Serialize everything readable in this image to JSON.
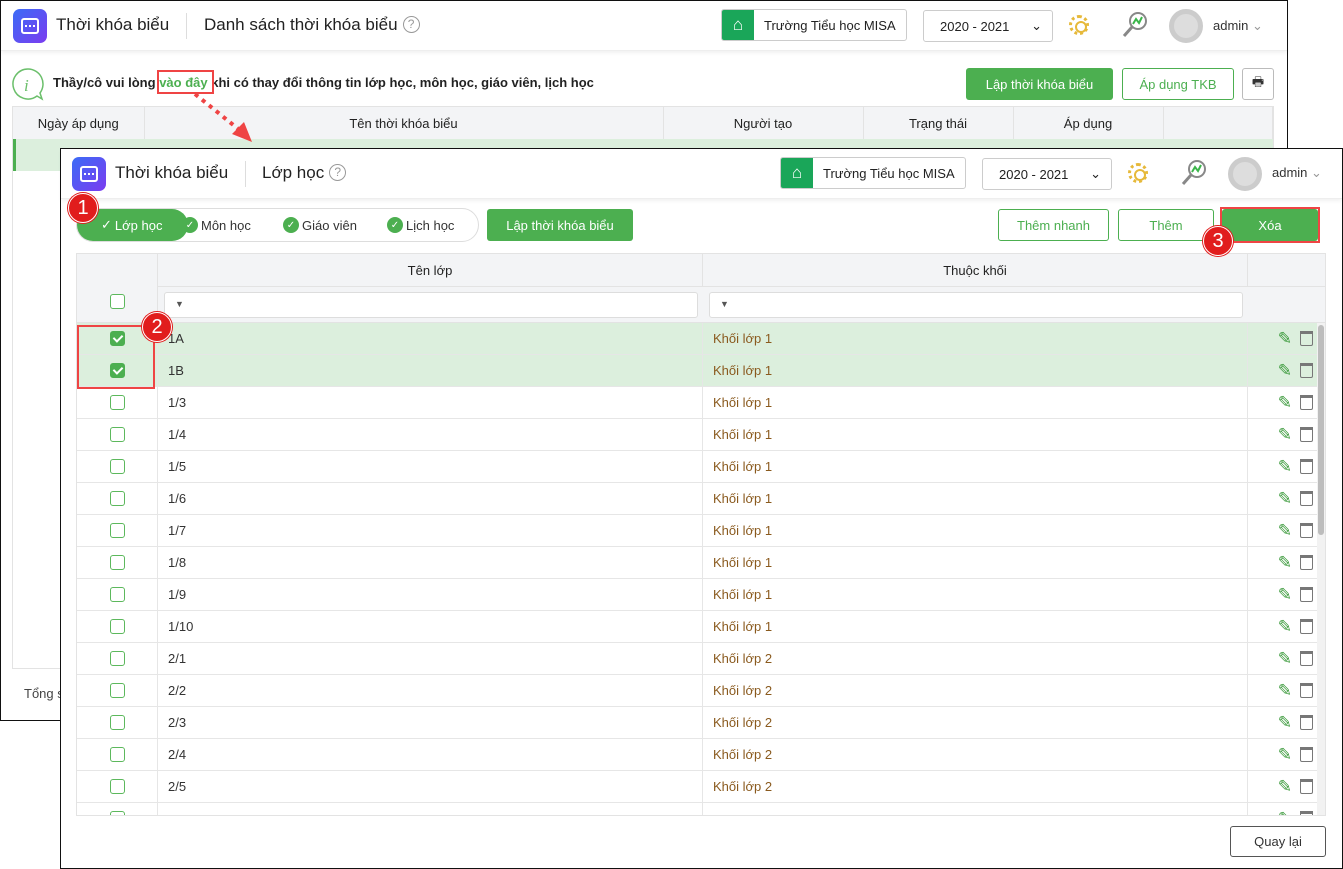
{
  "back": {
    "app_title": "Thời khóa biểu",
    "page_title": "Danh sách thời khóa biểu",
    "help": "?",
    "school": "Trường Tiểu học MISA",
    "year": "2020 - 2021",
    "user": "admin",
    "notice_pre": "Thầy/cô vui lòng ",
    "notice_link": "vào đây",
    "notice_post": " khi có thay đổi thông tin lớp học, môn học, giáo viên, lịch học",
    "btn_create": "Lập thời khóa biểu",
    "btn_apply": "Áp dụng TKB",
    "columns": [
      "Ngày áp dụng",
      "Tên thời khóa biểu",
      "Người tạo",
      "Trạng thái",
      "Áp dụng"
    ],
    "footer": "Tổng s"
  },
  "front": {
    "app_title": "Thời khóa biểu",
    "page_title": "Lớp học",
    "help": "?",
    "school": "Trường Tiểu học MISA",
    "year": "2020 - 2021",
    "user": "admin",
    "tabs": [
      "Lớp học",
      "Môn học",
      "Giáo viên",
      "Lịch học"
    ],
    "btn_create": "Lập thời khóa biểu",
    "btn_quick_add": "Thêm nhanh",
    "btn_add": "Thêm",
    "btn_delete": "Xóa",
    "columns": [
      "Tên lớp",
      "Thuộc khối"
    ],
    "rows": [
      {
        "name": "1A",
        "grade": "Khối lớp 1",
        "checked": true
      },
      {
        "name": "1B",
        "grade": "Khối lớp 1",
        "checked": true
      },
      {
        "name": "1/3",
        "grade": "Khối lớp 1",
        "checked": false
      },
      {
        "name": "1/4",
        "grade": "Khối lớp 1",
        "checked": false
      },
      {
        "name": "1/5",
        "grade": "Khối lớp 1",
        "checked": false
      },
      {
        "name": "1/6",
        "grade": "Khối lớp 1",
        "checked": false
      },
      {
        "name": "1/7",
        "grade": "Khối lớp 1",
        "checked": false
      },
      {
        "name": "1/8",
        "grade": "Khối lớp 1",
        "checked": false
      },
      {
        "name": "1/9",
        "grade": "Khối lớp 1",
        "checked": false
      },
      {
        "name": "1/10",
        "grade": "Khối lớp 1",
        "checked": false
      },
      {
        "name": "2/1",
        "grade": "Khối lớp 2",
        "checked": false
      },
      {
        "name": "2/2",
        "grade": "Khối lớp 2",
        "checked": false
      },
      {
        "name": "2/3",
        "grade": "Khối lớp 2",
        "checked": false
      },
      {
        "name": "2/4",
        "grade": "Khối lớp 2",
        "checked": false
      },
      {
        "name": "2/5",
        "grade": "Khối lớp 2",
        "checked": false
      },
      {
        "name": "",
        "grade": "",
        "checked": false
      }
    ],
    "btn_back": "Quay lại"
  },
  "annotations": [
    "1",
    "2",
    "3"
  ]
}
